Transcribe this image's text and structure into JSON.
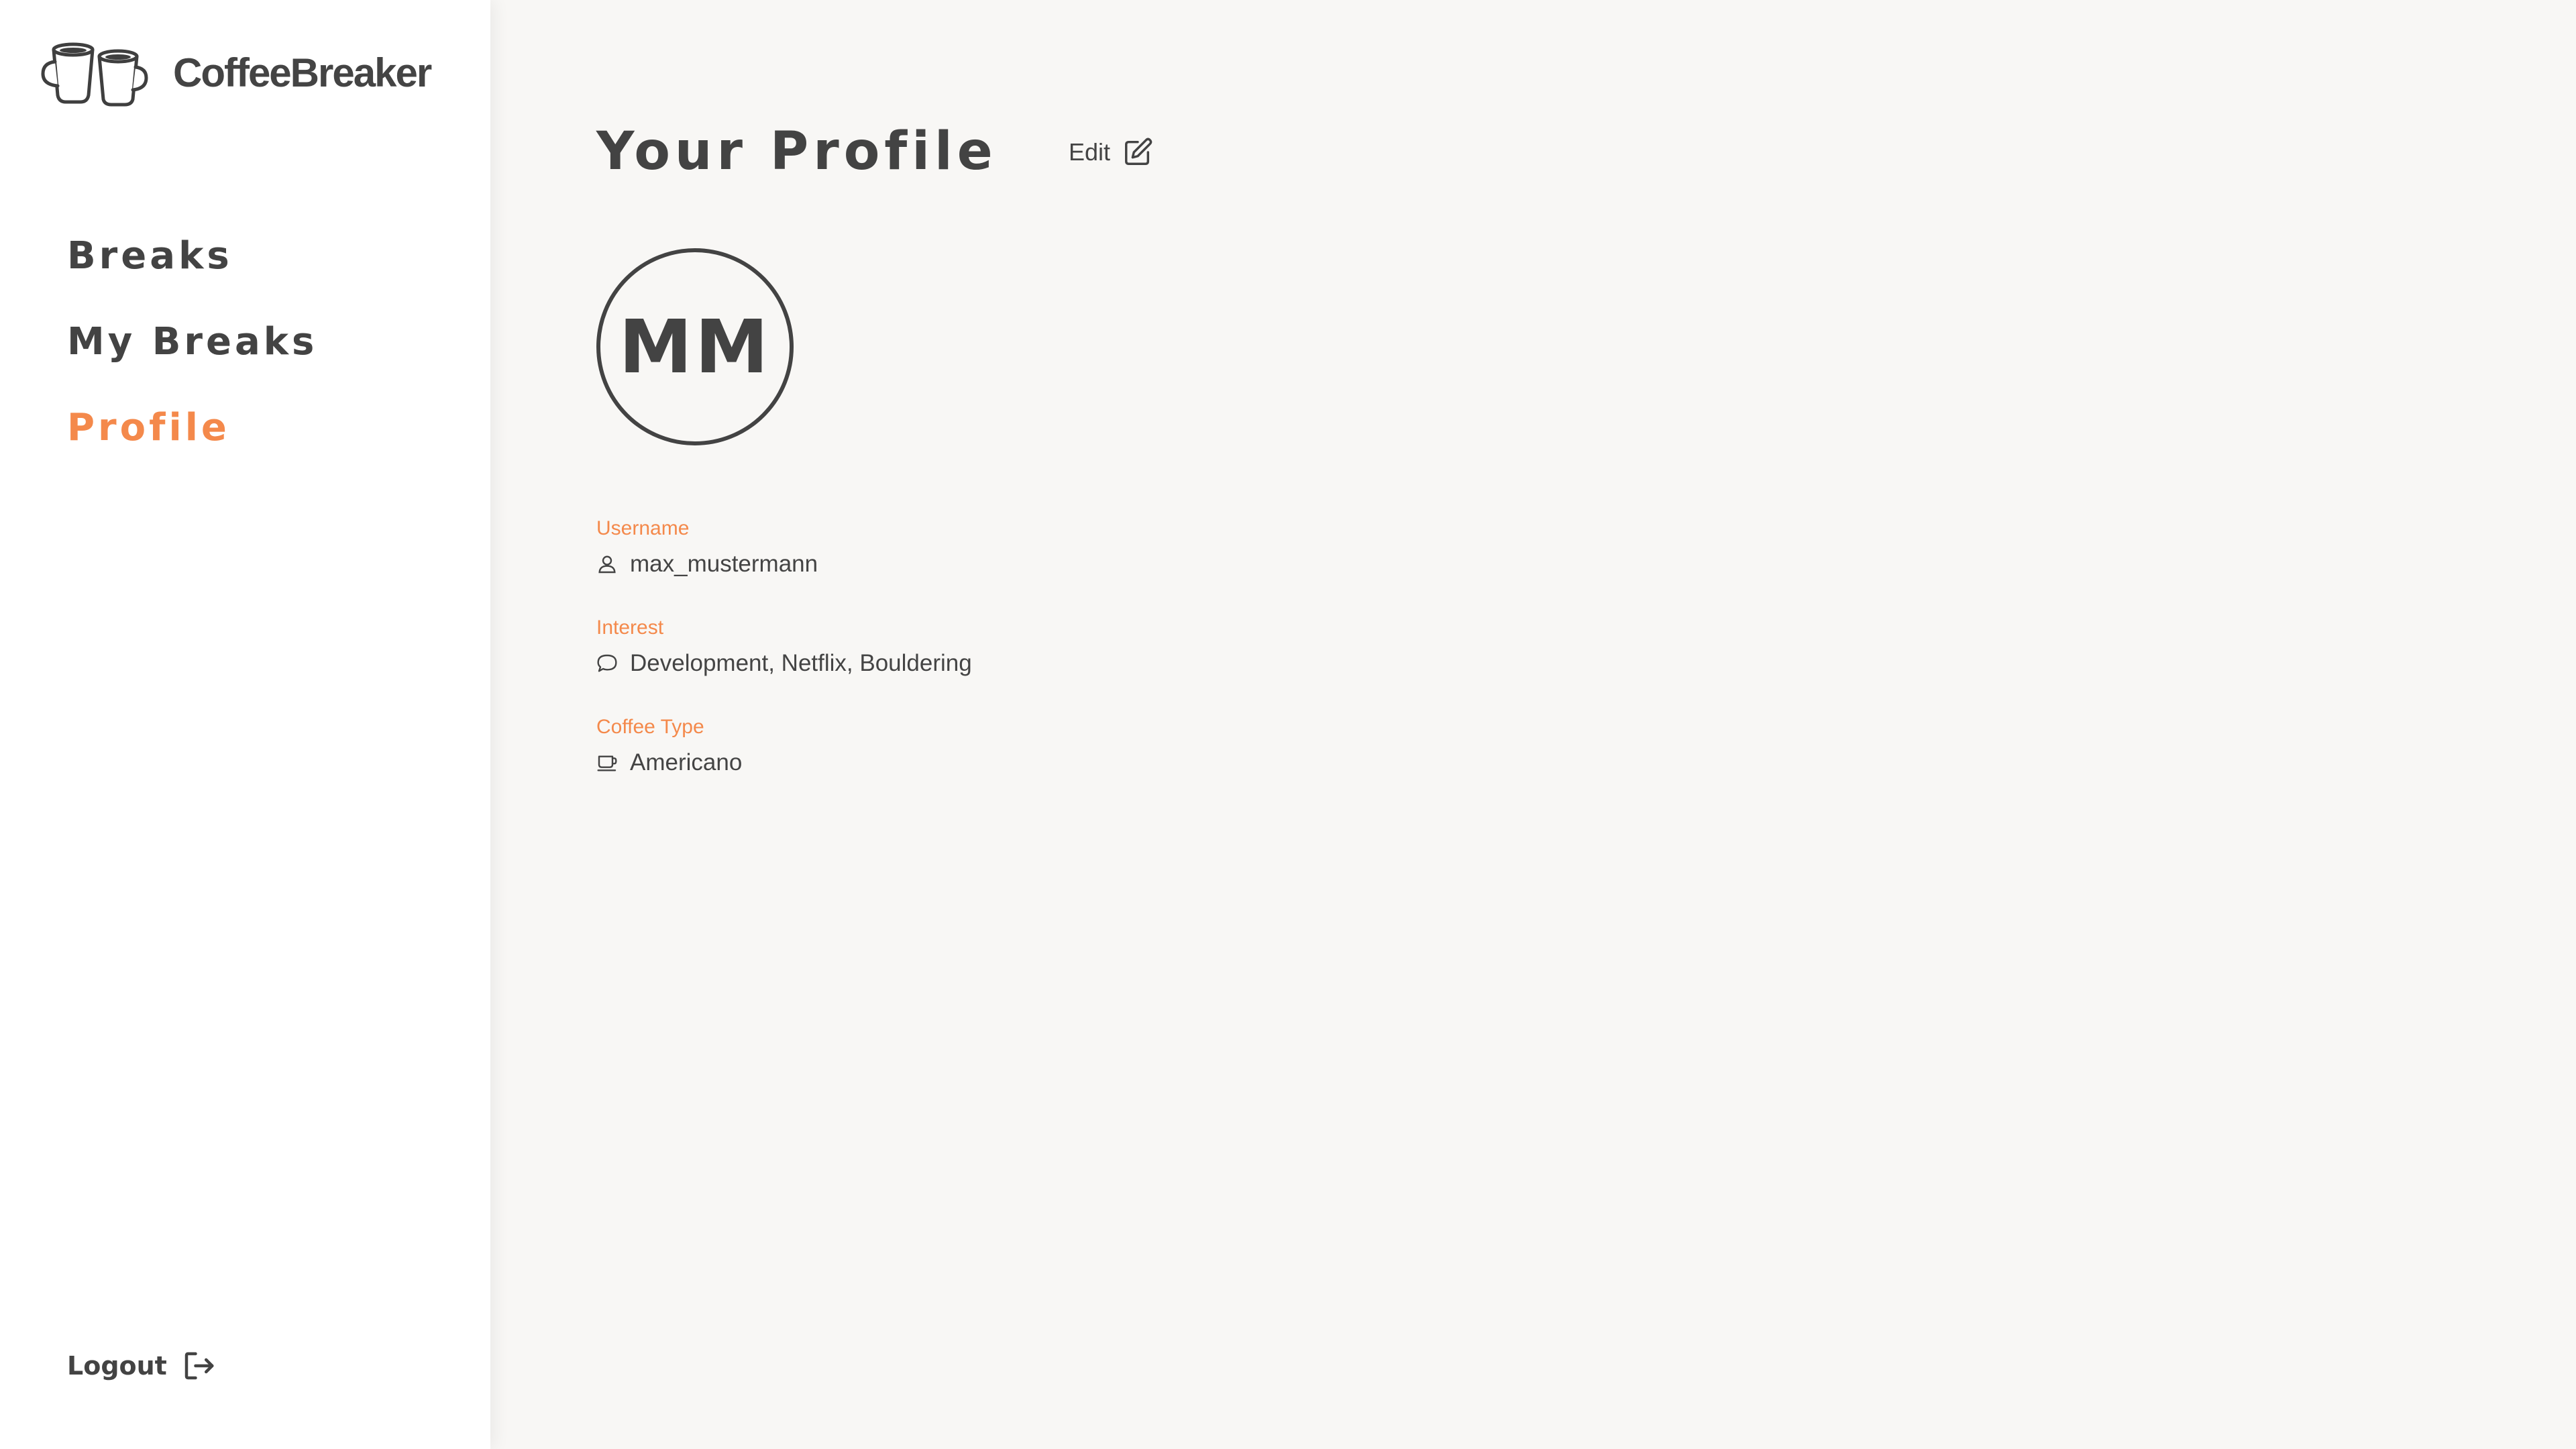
{
  "brand": {
    "name": "CoffeeBreaker",
    "logo_icon": "coffee-cups-logo"
  },
  "nav": {
    "items": [
      {
        "label": "Breaks",
        "active": false
      },
      {
        "label": "My Breaks",
        "active": false
      },
      {
        "label": "Profile",
        "active": true
      }
    ]
  },
  "logout": {
    "label": "Logout",
    "icon": "logout-icon"
  },
  "profile": {
    "title": "Your Profile",
    "edit_label": "Edit",
    "edit_icon": "edit-icon",
    "initials": "MM",
    "fields": [
      {
        "label": "Username",
        "value": "max_mustermann",
        "icon": "user-icon"
      },
      {
        "label": "Interest",
        "value": "Development, Netflix, Bouldering",
        "icon": "speech-bubble-icon"
      },
      {
        "label": "Coffee Type",
        "value": "Americano",
        "icon": "coffee-cup-icon"
      }
    ]
  },
  "colors": {
    "accent": "#f4894b",
    "text": "#434343",
    "background": "#f8f7f5",
    "sidebar": "#ffffff"
  }
}
